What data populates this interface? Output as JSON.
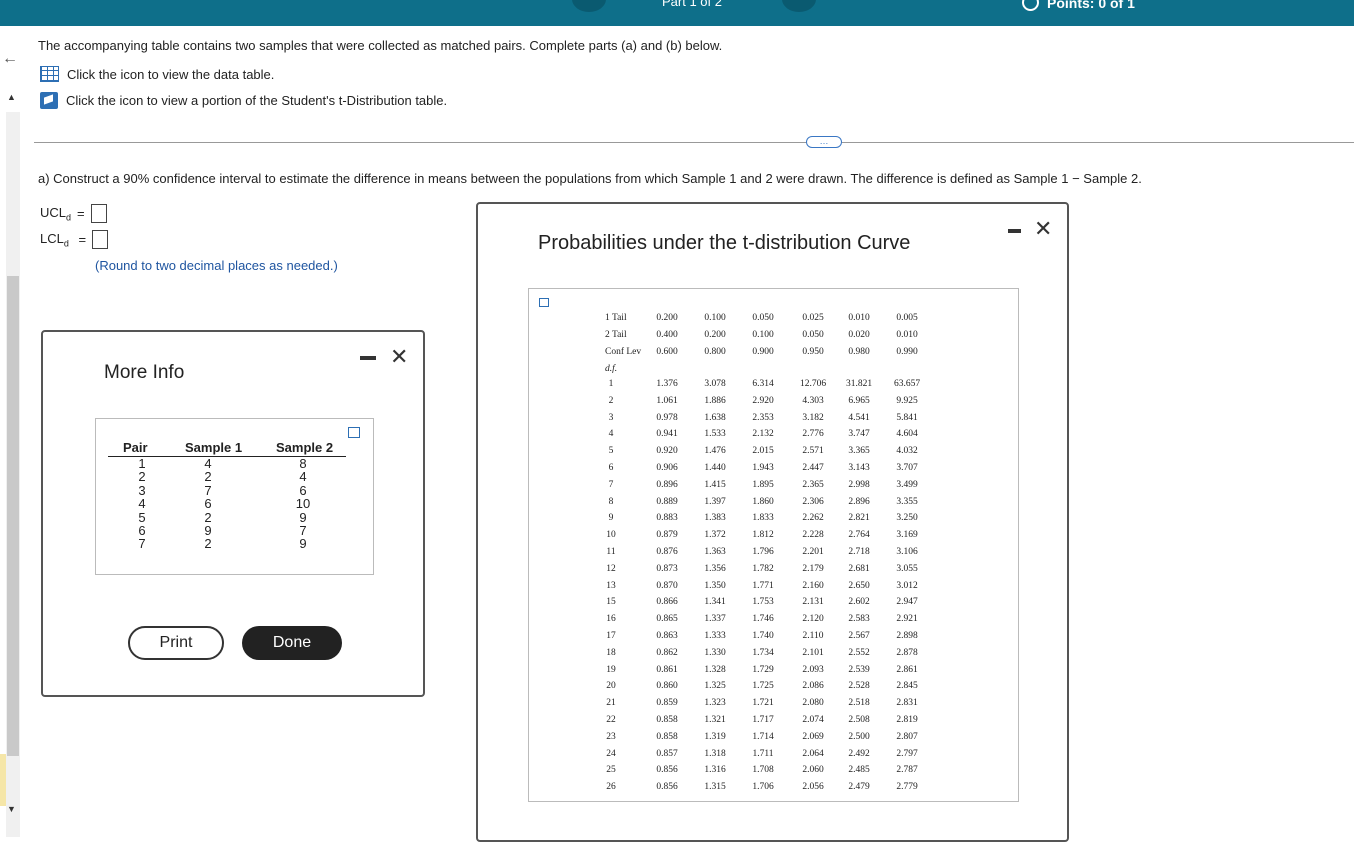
{
  "topbar": {
    "part": "Part 1 of 2",
    "points": "Points: 0 of 1"
  },
  "intro": "The accompanying table contains two samples that were collected as matched pairs. Complete parts (a) and (b) below.",
  "links": {
    "data_table": "Click the icon to view the data table.",
    "t_table": "Click the icon to view a portion of the Student's t-Distribution table."
  },
  "more_button": "…",
  "question": "a) Construct a 90% confidence interval to estimate the difference in means between the populations from which Sample 1 and 2 were drawn. The difference is defined as Sample 1 − Sample 2.",
  "answers": {
    "ucl_label": "UCL",
    "lcl_label": "LCL",
    "sub": "d",
    "ucl_value": "",
    "lcl_value": ""
  },
  "round_note": "(Round to two decimal places as needed.)",
  "more_info": {
    "title": "More Info",
    "headers": [
      "Pair",
      "Sample 1",
      "Sample 2"
    ],
    "pairs": [
      "1",
      "2",
      "3",
      "4",
      "5",
      "6",
      "7"
    ],
    "sample1": [
      "4",
      "2",
      "7",
      "6",
      "2",
      "9",
      "2"
    ],
    "sample2": [
      "8",
      "4",
      "6",
      "10",
      "9",
      "7",
      "9"
    ],
    "print_label": "Print",
    "done_label": "Done"
  },
  "t_dist": {
    "title": "Probabilities under the t-distribution Curve",
    "row_labels": [
      "1 Tail",
      "2 Tail",
      "Conf Lev",
      "d.f."
    ],
    "one_tail": [
      "0.200",
      "0.100",
      "0.050",
      "0.025",
      "0.010",
      "0.005"
    ],
    "two_tail": [
      "0.400",
      "0.200",
      "0.100",
      "0.050",
      "0.020",
      "0.010"
    ],
    "conf_lev": [
      "0.600",
      "0.800",
      "0.900",
      "0.950",
      "0.980",
      "0.990"
    ],
    "rows": [
      [
        "1",
        "1.376",
        "3.078",
        "6.314",
        "12.706",
        "31.821",
        "63.657"
      ],
      [
        "2",
        "1.061",
        "1.886",
        "2.920",
        "4.303",
        "6.965",
        "9.925"
      ],
      [
        "3",
        "0.978",
        "1.638",
        "2.353",
        "3.182",
        "4.541",
        "5.841"
      ],
      [
        "4",
        "0.941",
        "1.533",
        "2.132",
        "2.776",
        "3.747",
        "4.604"
      ],
      [
        "5",
        "0.920",
        "1.476",
        "2.015",
        "2.571",
        "3.365",
        "4.032"
      ],
      [
        "6",
        "0.906",
        "1.440",
        "1.943",
        "2.447",
        "3.143",
        "3.707"
      ],
      [
        "7",
        "0.896",
        "1.415",
        "1.895",
        "2.365",
        "2.998",
        "3.499"
      ],
      [
        "8",
        "0.889",
        "1.397",
        "1.860",
        "2.306",
        "2.896",
        "3.355"
      ],
      [
        "9",
        "0.883",
        "1.383",
        "1.833",
        "2.262",
        "2.821",
        "3.250"
      ],
      [
        "10",
        "0.879",
        "1.372",
        "1.812",
        "2.228",
        "2.764",
        "3.169"
      ],
      [
        "11",
        "0.876",
        "1.363",
        "1.796",
        "2.201",
        "2.718",
        "3.106"
      ],
      [
        "12",
        "0.873",
        "1.356",
        "1.782",
        "2.179",
        "2.681",
        "3.055"
      ],
      [
        "13",
        "0.870",
        "1.350",
        "1.771",
        "2.160",
        "2.650",
        "3.012"
      ],
      [
        "15",
        "0.866",
        "1.341",
        "1.753",
        "2.131",
        "2.602",
        "2.947"
      ],
      [
        "16",
        "0.865",
        "1.337",
        "1.746",
        "2.120",
        "2.583",
        "2.921"
      ],
      [
        "17",
        "0.863",
        "1.333",
        "1.740",
        "2.110",
        "2.567",
        "2.898"
      ],
      [
        "18",
        "0.862",
        "1.330",
        "1.734",
        "2.101",
        "2.552",
        "2.878"
      ],
      [
        "19",
        "0.861",
        "1.328",
        "1.729",
        "2.093",
        "2.539",
        "2.861"
      ],
      [
        "20",
        "0.860",
        "1.325",
        "1.725",
        "2.086",
        "2.528",
        "2.845"
      ],
      [
        "21",
        "0.859",
        "1.323",
        "1.721",
        "2.080",
        "2.518",
        "2.831"
      ],
      [
        "22",
        "0.858",
        "1.321",
        "1.717",
        "2.074",
        "2.508",
        "2.819"
      ],
      [
        "23",
        "0.858",
        "1.319",
        "1.714",
        "2.069",
        "2.500",
        "2.807"
      ],
      [
        "24",
        "0.857",
        "1.318",
        "1.711",
        "2.064",
        "2.492",
        "2.797"
      ],
      [
        "25",
        "0.856",
        "1.316",
        "1.708",
        "2.060",
        "2.485",
        "2.787"
      ],
      [
        "26",
        "0.856",
        "1.315",
        "1.706",
        "2.056",
        "2.479",
        "2.779"
      ]
    ]
  }
}
